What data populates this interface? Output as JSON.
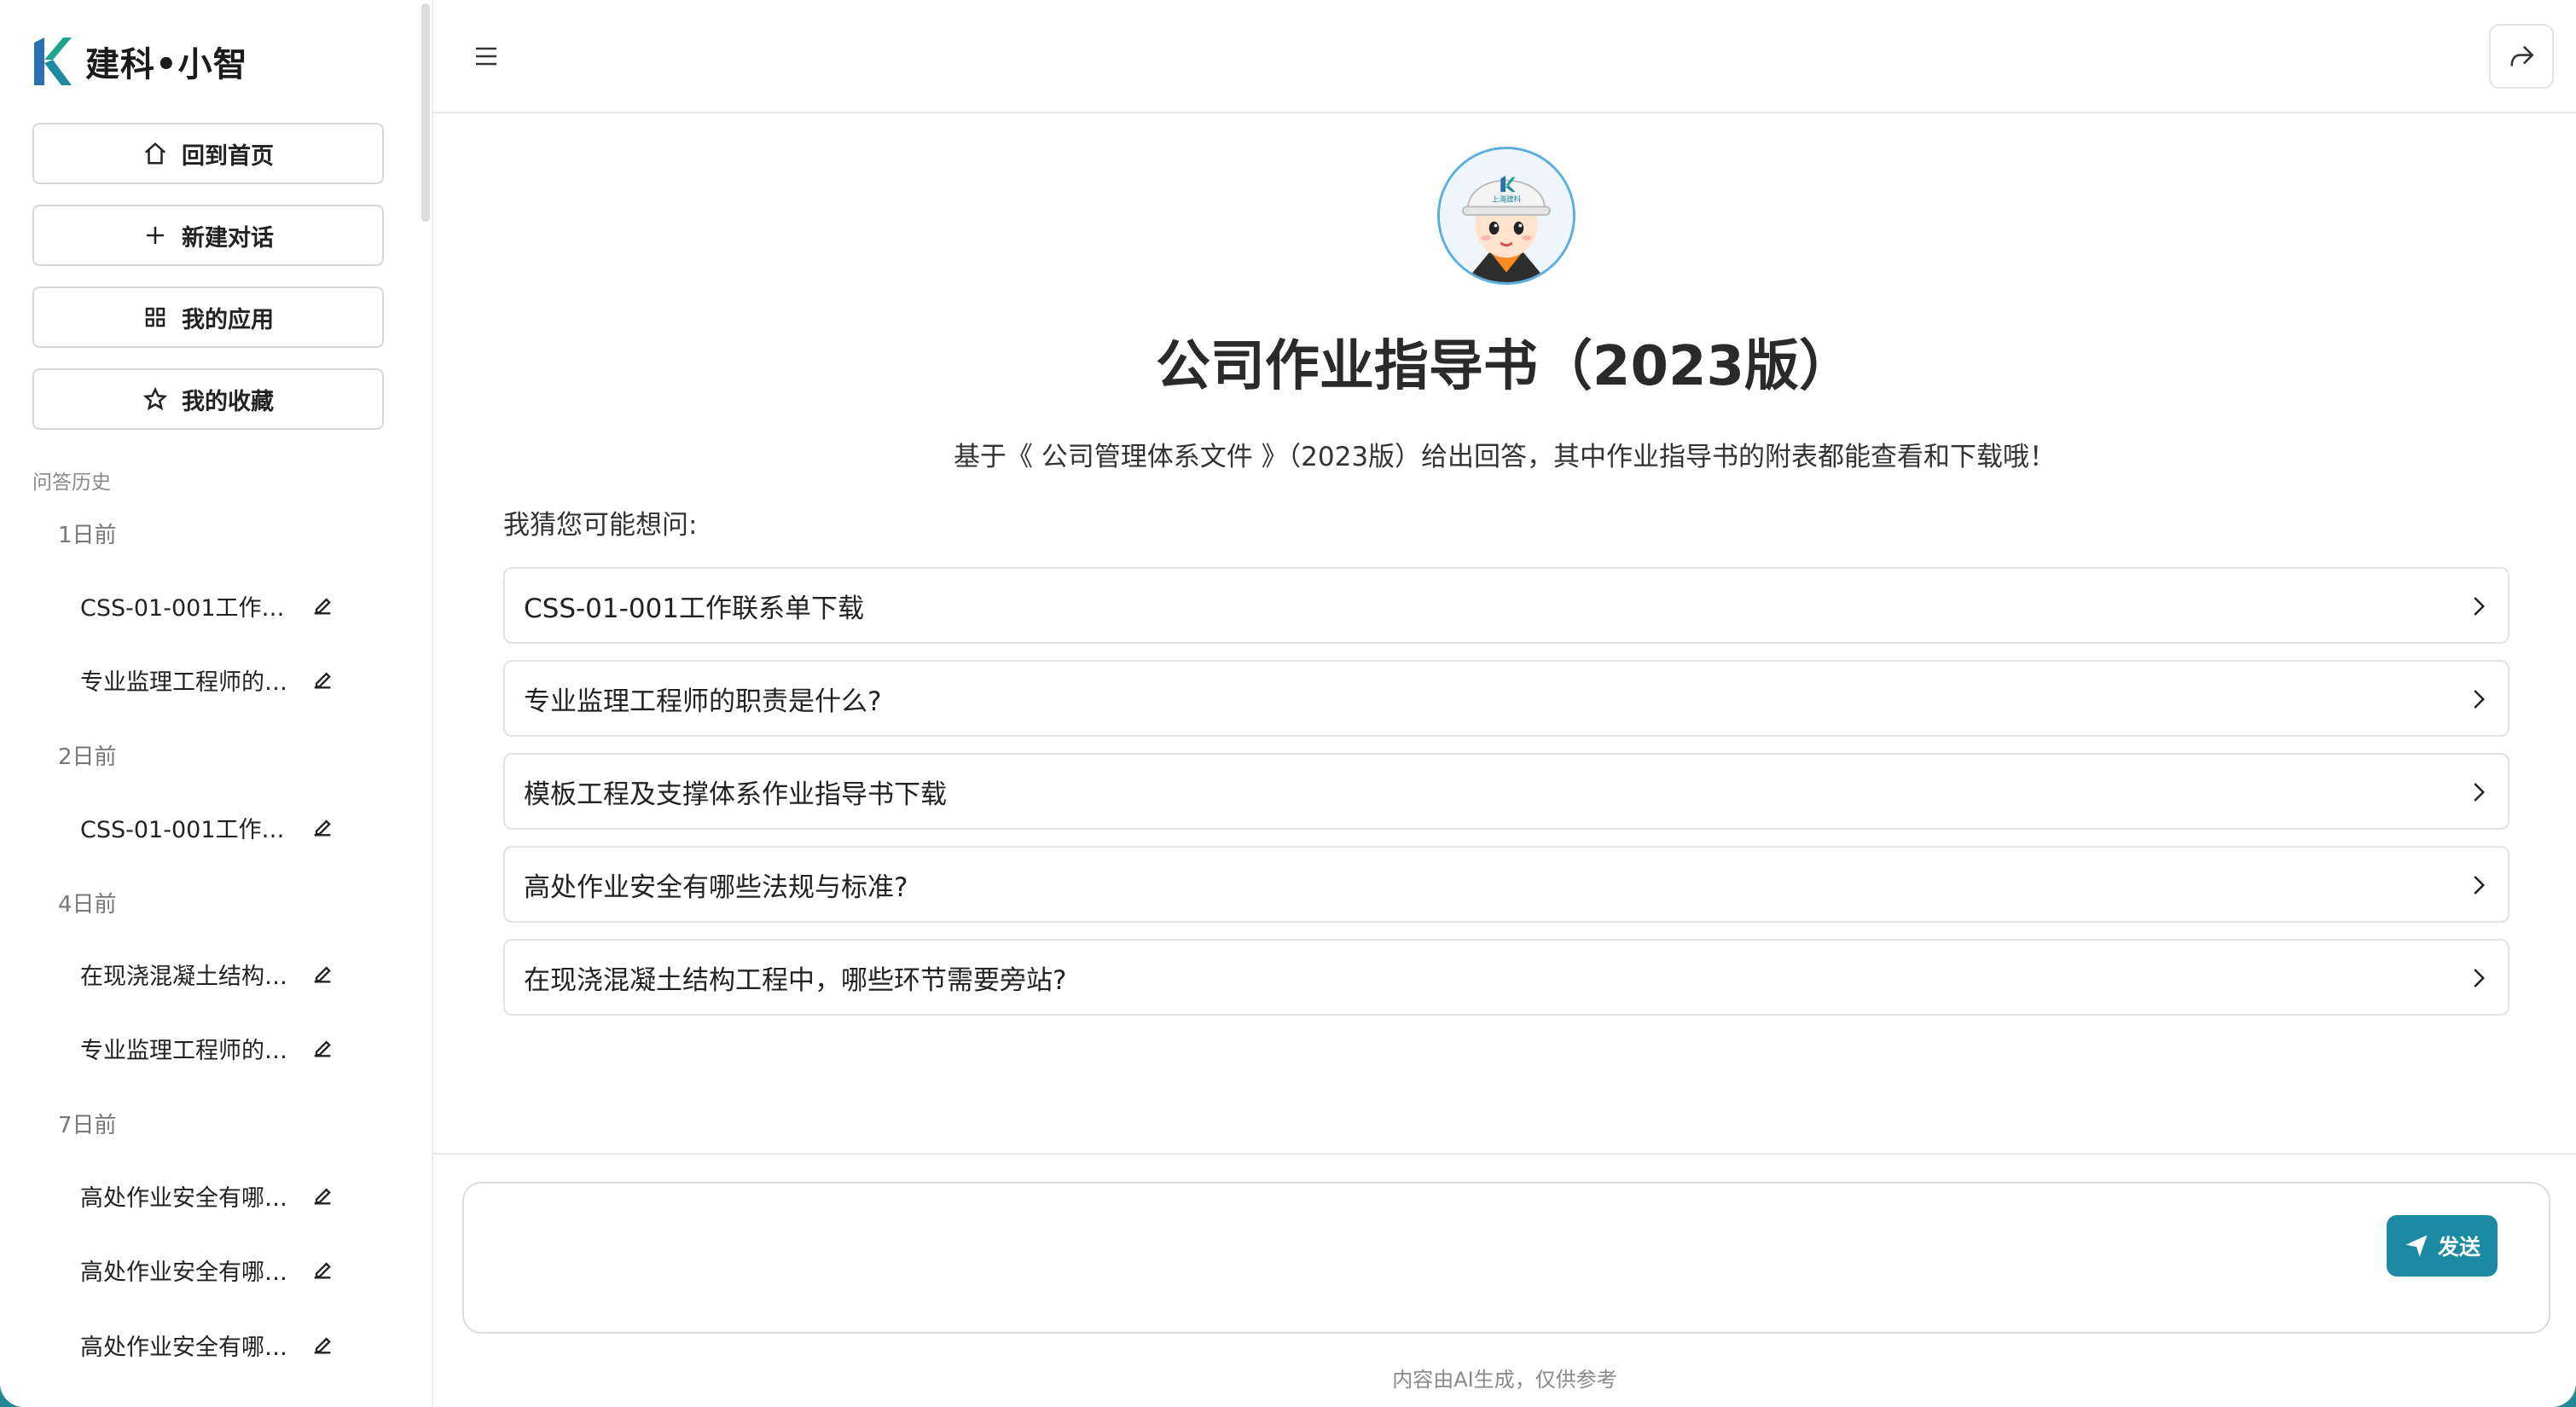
{
  "brand": {
    "name": "建科•小智",
    "accent": "#1c8aa3"
  },
  "sidebar": {
    "nav": [
      {
        "label": "回到首页",
        "icon": "home-icon"
      },
      {
        "label": "新建对话",
        "icon": "plus-icon"
      },
      {
        "label": "我的应用",
        "icon": "grid-icon"
      },
      {
        "label": "我的收藏",
        "icon": "star-icon"
      }
    ],
    "history_title": "问答历史",
    "groups": [
      {
        "label": "1日前",
        "items": [
          "CSS-01-001工作…",
          "专业监理工程师的…"
        ]
      },
      {
        "label": "2日前",
        "items": [
          "CSS-01-001工作…"
        ]
      },
      {
        "label": "4日前",
        "items": [
          "在现浇混凝土结构…",
          "专业监理工程师的…"
        ]
      },
      {
        "label": "7日前",
        "items": [
          "高处作业安全有哪…",
          "高处作业安全有哪…",
          "高处作业安全有哪…"
        ]
      }
    ]
  },
  "main": {
    "title": "公司作业指导书（2023版）",
    "subtitle": "基于《 公司管理体系文件 》（2023版）给出回答，其中作业指导书的附表都能查看和下载哦！",
    "guess_label": "我猜您可能想问:",
    "suggestions": [
      "CSS-01-001工作联系单下载",
      "专业监理工程师的职责是什么?",
      "模板工程及支撑体系作业指导书下载",
      "高处作业安全有哪些法规与标准?",
      "在现浇混凝土结构工程中，哪些环节需要旁站?"
    ],
    "avatar_badge": "上海建科"
  },
  "input": {
    "value": "",
    "send_label": "发送"
  },
  "footer": {
    "note": "内容由AI生成，仅供参考"
  }
}
